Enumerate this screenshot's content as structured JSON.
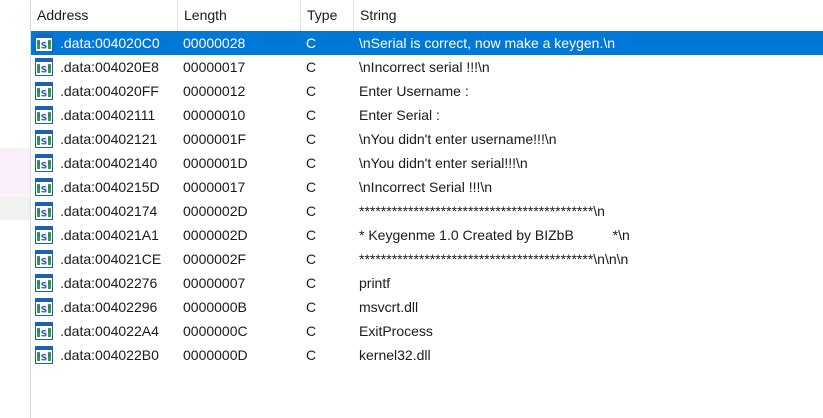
{
  "columns": {
    "address": "Address",
    "length": "Length",
    "type": "Type",
    "string": "String"
  },
  "icon": "string-item-icon",
  "icon_glyph": "'S'",
  "colors": {
    "selection": "#0078d7",
    "icon_blue": "#1f5fbf",
    "icon_green": "#3c9a3c"
  },
  "selected_row": 0,
  "rows": [
    {
      "address": ".data:004020C0",
      "length": "00000028",
      "type": "C",
      "string": "\\nSerial is correct, now make a keygen.\\n"
    },
    {
      "address": ".data:004020E8",
      "length": "00000017",
      "type": "C",
      "string": "\\nIncorrect serial !!!\\n"
    },
    {
      "address": ".data:004020FF",
      "length": "00000012",
      "type": "C",
      "string": "Enter Username :"
    },
    {
      "address": ".data:00402111",
      "length": "00000010",
      "type": "C",
      "string": "Enter Serial :"
    },
    {
      "address": ".data:00402121",
      "length": "0000001F",
      "type": "C",
      "string": "\\nYou didn't enter username!!!\\n"
    },
    {
      "address": ".data:00402140",
      "length": "0000001D",
      "type": "C",
      "string": "\\nYou didn't enter serial!!!\\n"
    },
    {
      "address": ".data:0040215D",
      "length": "00000017",
      "type": "C",
      "string": "\\nIncorrect Serial !!!\\n"
    },
    {
      "address": ".data:00402174",
      "length": "0000002D",
      "type": "C",
      "string": "*******************************************\\n"
    },
    {
      "address": ".data:004021A1",
      "length": "0000002D",
      "type": "C",
      "string": "* Keygenme 1.0 Created by BIZbB          *\\n"
    },
    {
      "address": ".data:004021CE",
      "length": "0000002F",
      "type": "C",
      "string": "*******************************************\\n\\n\\n"
    },
    {
      "address": ".data:00402276",
      "length": "00000007",
      "type": "C",
      "string": "printf"
    },
    {
      "address": ".data:00402296",
      "length": "0000000B",
      "type": "C",
      "string": "msvcrt.dll"
    },
    {
      "address": ".data:004022A4",
      "length": "0000000C",
      "type": "C",
      "string": "ExitProcess"
    },
    {
      "address": ".data:004022B0",
      "length": "0000000D",
      "type": "C",
      "string": "kernel32.dll"
    }
  ]
}
